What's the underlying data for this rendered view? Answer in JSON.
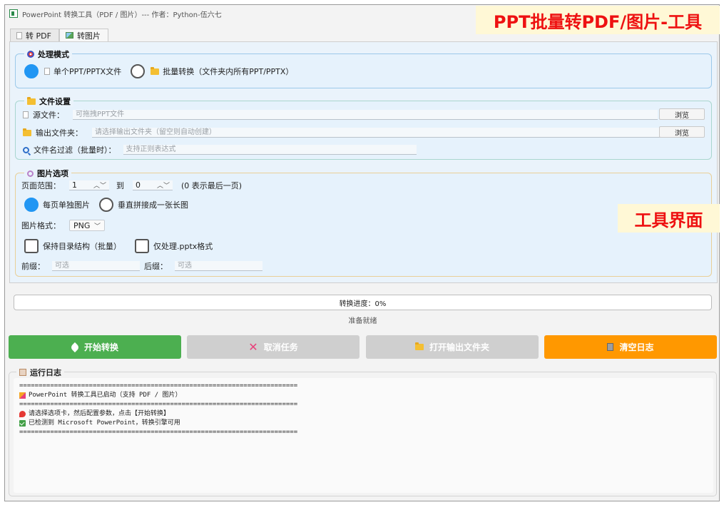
{
  "window": {
    "title": "PowerPoint 转换工具（PDF / 图片）--- 作者：Python-伍六七"
  },
  "overlay": {
    "top_label": "PPT批量转PDF/图片-工具",
    "mid_label": "工具界面"
  },
  "tabs": [
    {
      "label": "转 PDF",
      "icon": "document-icon",
      "active": false
    },
    {
      "label": "转图片",
      "icon": "image-icon",
      "active": true
    }
  ],
  "mode": {
    "title": "处理模式",
    "single_label": "单个PPT/PPTX文件",
    "batch_label": "批量转换（文件夹内所有PPT/PPTX）",
    "selected": "single"
  },
  "files": {
    "title": "文件设置",
    "source_label": "源文件：",
    "source_placeholder": "可拖拽PPT文件",
    "source_value": "",
    "output_label": "输出文件夹：",
    "output_placeholder": "请选择输出文件夹（留空则自动创建）",
    "output_value": "",
    "filter_label": "文件名过滤（批量时）：",
    "filter_placeholder": "支持正则表达式",
    "filter_value": "",
    "browse_label": "浏览"
  },
  "image_options": {
    "title": "图片选项",
    "page_range_label": "页面范围：",
    "range_from": "1",
    "range_to_label": "到",
    "range_to": "0",
    "range_hint": "(0 表示最后一页)",
    "each_page_label": "每页单独图片",
    "stitch_label": "垂直拼接成一张长图",
    "output_mode": "each_page",
    "format_label": "图片格式：",
    "format_value": "PNG",
    "keep_structure_label": "保持目录结构（批量）",
    "keep_structure_checked": false,
    "pptx_only_label": "仅处理.pptx格式",
    "pptx_only_checked": false,
    "prefix_label": "前缀：",
    "prefix_placeholder": "可选",
    "suffix_label": "后缀：",
    "suffix_placeholder": "可选"
  },
  "progress": {
    "label": "转换进度：0%",
    "value_percent": 0,
    "status": "准备就绪"
  },
  "actions": {
    "start": "开始转换",
    "cancel": "取消任务",
    "open_folder": "打开输出文件夹",
    "clear_log": "清空日志"
  },
  "log": {
    "title": "运行日志",
    "lines": [
      {
        "icon": "",
        "text": "========================================================================"
      },
      {
        "icon": "party-icon",
        "text": "PowerPoint 转换工具已启动（支持 PDF / 图片）"
      },
      {
        "icon": "",
        "text": "========================================================================"
      },
      {
        "icon": "pin-icon",
        "text": "请选择选项卡，然后配置参数，点击【开始转换】"
      },
      {
        "icon": "check-icon",
        "text": "已检测到 Microsoft PowerPoint，转换引擎可用"
      },
      {
        "icon": "",
        "text": "========================================================================"
      }
    ]
  },
  "colors": {
    "accent": "#2196f3",
    "start_button": "#4caf50",
    "clear_button": "#ff9800",
    "disabled_button": "#cfcfcf",
    "overlay_text": "#ee1111"
  }
}
